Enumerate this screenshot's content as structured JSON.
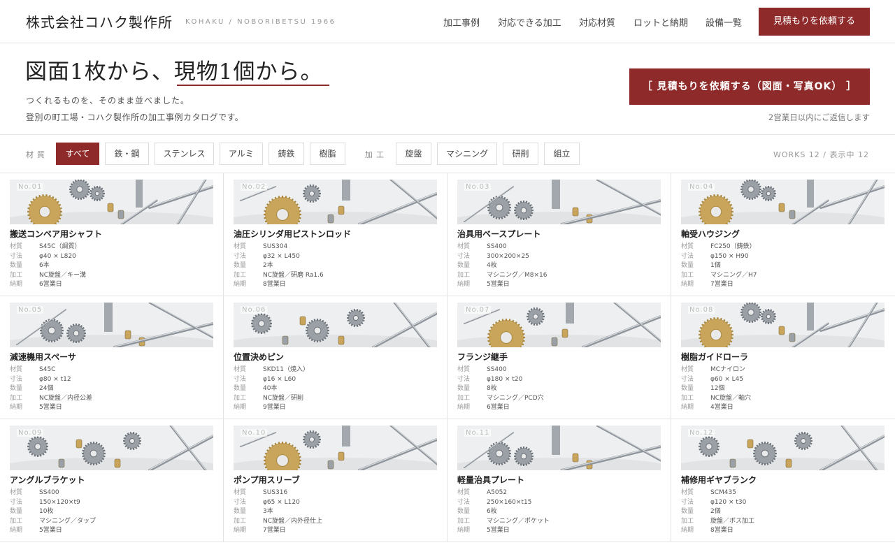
{
  "header": {
    "logo": "株式会社コハク製作所",
    "logo_sub": "KOHAKU / NOBORIBETSU 1966",
    "nav": [
      "加工事例",
      "対応できる加工",
      "対応材質",
      "ロットと納期",
      "設備一覧"
    ],
    "cta": "見積もりを依頼する"
  },
  "hero": {
    "title_a": "図面1枚から、",
    "title_b": "現物1個から。",
    "sub1": "つくれるものを、そのまま並べました。",
    "sub2": "登別の町工場・コハク製作所の加工事例カタログです。",
    "cta": "［ 見積もりを依頼する（図面・写真OK） ］",
    "note": "2営業日以内にご返信します"
  },
  "filters": {
    "material_label": "材質",
    "materials": [
      "すべて",
      "鉄・鋼",
      "ステンレス",
      "アルミ",
      "鋳鉄",
      "樹脂"
    ],
    "process_label": "加工",
    "processes": [
      "旋盤",
      "マシニング",
      "研削",
      "組立"
    ],
    "count": "WORKS 12 / 表示中 12"
  },
  "spec_keys": {
    "material": "材質",
    "size": "寸法",
    "qty": "数量",
    "process": "加工",
    "lead": "納期"
  },
  "works": [
    {
      "no": "No.01",
      "title": "搬送コンベア用シャフト",
      "material": "S45C（調質）",
      "size": "φ40 × L820",
      "qty": "6本",
      "process": "NC旋盤／キー溝",
      "lead": "6営業日"
    },
    {
      "no": "No.02",
      "title": "油圧シリンダ用ピストンロッド",
      "material": "SUS304",
      "size": "φ32 × L450",
      "qty": "2本",
      "process": "NC旋盤／研磨 Ra1.6",
      "lead": "8営業日"
    },
    {
      "no": "No.03",
      "title": "治具用ベースプレート",
      "material": "SS400",
      "size": "300×200×25",
      "qty": "4枚",
      "process": "マシニング／M8×16",
      "lead": "5営業日"
    },
    {
      "no": "No.04",
      "title": "軸受ハウジング",
      "material": "FC250（鋳鉄）",
      "size": "φ150 × H90",
      "qty": "1個",
      "process": "マシニング／H7",
      "lead": "7営業日"
    },
    {
      "no": "No.05",
      "title": "減速機用スペーサ",
      "material": "S45C",
      "size": "φ80 × t12",
      "qty": "24個",
      "process": "NC旋盤／内径公差",
      "lead": "5営業日"
    },
    {
      "no": "No.06",
      "title": "位置決めピン",
      "material": "SKD11（焼入）",
      "size": "φ16 × L60",
      "qty": "40本",
      "process": "NC旋盤／研削",
      "lead": "9営業日"
    },
    {
      "no": "No.07",
      "title": "フランジ継手",
      "material": "SS400",
      "size": "φ180 × t20",
      "qty": "8枚",
      "process": "マシニング／PCD穴",
      "lead": "6営業日"
    },
    {
      "no": "No.08",
      "title": "樹脂ガイドローラ",
      "material": "MCナイロン",
      "size": "φ60 × L45",
      "qty": "12個",
      "process": "NC旋盤／軸穴",
      "lead": "4営業日"
    },
    {
      "no": "No.09",
      "title": "アングルブラケット",
      "material": "SS400",
      "size": "150×120×t9",
      "qty": "10枚",
      "process": "マシニング／タップ",
      "lead": "5営業日"
    },
    {
      "no": "No.10",
      "title": "ポンプ用スリーブ",
      "material": "SUS316",
      "size": "φ65 × L120",
      "qty": "3本",
      "process": "NC旋盤／内外径仕上",
      "lead": "7営業日"
    },
    {
      "no": "No.11",
      "title": "軽量治具プレート",
      "material": "A5052",
      "size": "250×160×t15",
      "qty": "6枚",
      "process": "マシニング／ポケット",
      "lead": "5営業日"
    },
    {
      "no": "No.12",
      "title": "補修用ギヤブランク",
      "material": "SCM435",
      "size": "φ120 × t30",
      "qty": "2個",
      "process": "旋盤／ボス加工",
      "lead": "8営業日"
    }
  ],
  "colors": {
    "accent": "#8f2a2a",
    "brass": "#c9a55c",
    "steel": "#9aa0a6"
  },
  "icons": [
    "gear-photo",
    "shaft-photo",
    "bushing-photo"
  ]
}
